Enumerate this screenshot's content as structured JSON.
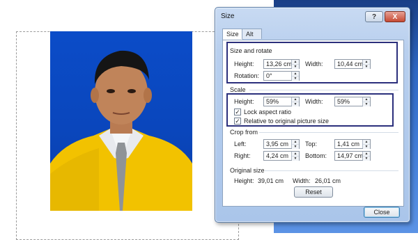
{
  "dialog": {
    "title": "Size",
    "title_buttons": {
      "help": "?",
      "close": "X"
    },
    "tabs": [
      {
        "label": "Size"
      },
      {
        "label": "Alt Text"
      }
    ],
    "size_and_rotate": {
      "heading": "Size and rotate",
      "height_label": "Height:",
      "height_value": "13,26 cm",
      "width_label": "Width:",
      "width_value": "10,44 cm",
      "rotation_label": "Rotation:",
      "rotation_value": "0°"
    },
    "scale": {
      "heading": "Scale",
      "height_label": "Height:",
      "height_value": "59%",
      "width_label": "Width:",
      "width_value": "59%",
      "lock_aspect_label": "Lock aspect ratio",
      "lock_aspect_checked": true,
      "relative_label": "Relative to original picture size",
      "relative_checked": true
    },
    "crop_from": {
      "heading": "Crop from",
      "left_label": "Left:",
      "left_value": "3,95 cm",
      "top_label": "Top:",
      "top_value": "1,41 cm",
      "right_label": "Right:",
      "right_value": "4,24 cm",
      "bottom_label": "Bottom:",
      "bottom_value": "14,97 cm"
    },
    "original_size": {
      "heading": "Original size",
      "height_label": "Height:",
      "height_value": "39,01 cm",
      "width_label": "Width:",
      "width_value": "26,01 cm",
      "reset_label": "Reset"
    },
    "close_label": "Close"
  },
  "colors": {
    "photo_background": "#0b4cc8",
    "jacket": "#f2c200",
    "highlight_border": "#2b2f7c"
  }
}
